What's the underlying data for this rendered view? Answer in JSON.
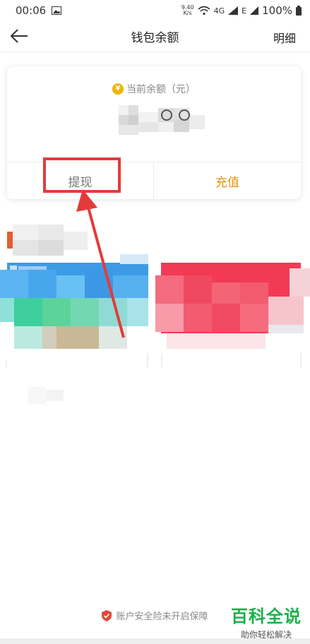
{
  "status_bar": {
    "time": "00:06",
    "speed_value": "9.40",
    "speed_unit": "K/s",
    "battery": "100%"
  },
  "nav": {
    "title": "钱包余额",
    "detail_label": "明细"
  },
  "balance_card": {
    "coin_symbol": "¥",
    "label": "当前余额（元）",
    "withdraw_label": "提现",
    "recharge_label": "充值"
  },
  "footer": {
    "security_text": "账户安全险未开启保障"
  },
  "watermark": {
    "line1": "百科全说",
    "line2": "助你轻松解决"
  },
  "colors": {
    "accent_orange": "#e0930c",
    "highlight_red": "#e33b3b",
    "watermark_green": "#1ab04b"
  }
}
